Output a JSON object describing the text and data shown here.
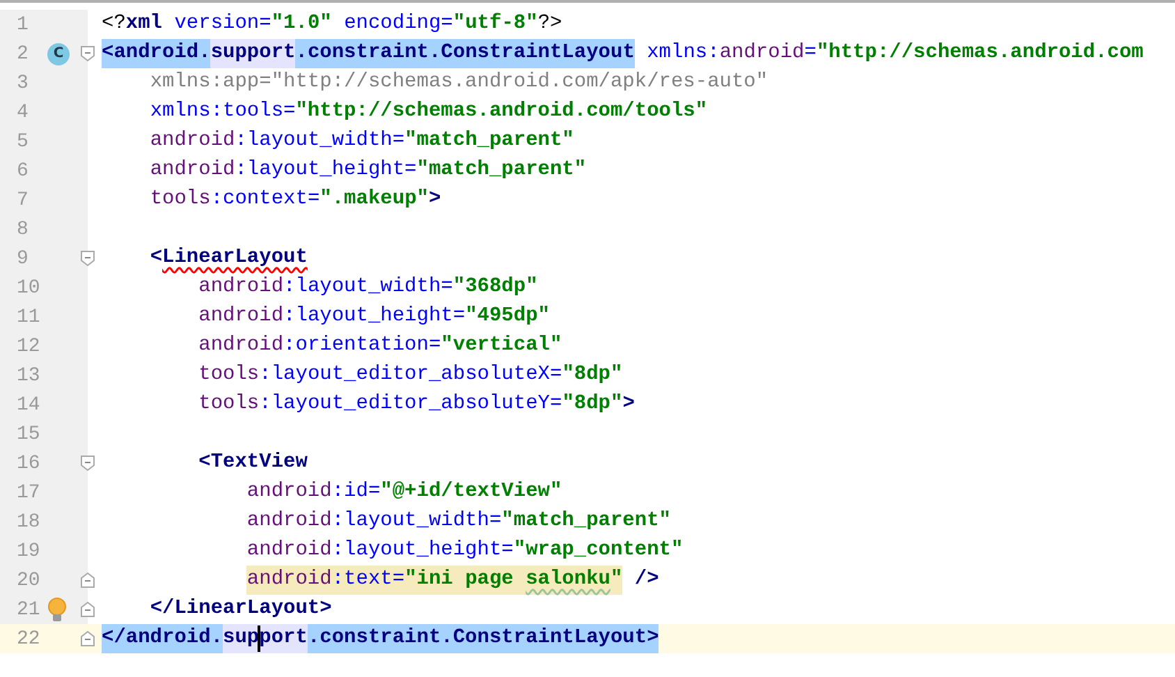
{
  "editor": {
    "lines": [
      {
        "number": "1",
        "current": false,
        "tokens": [
          {
            "kind": "punct",
            "text": "<?"
          },
          {
            "kind": "tag",
            "text": "xml "
          },
          {
            "kind": "attr",
            "text": "version="
          },
          {
            "kind": "value",
            "text": "\"1.0\" "
          },
          {
            "kind": "attr",
            "text": "encoding="
          },
          {
            "kind": "value",
            "text": "\"utf-8\""
          },
          {
            "kind": "punct",
            "text": "?>"
          }
        ]
      },
      {
        "number": "2",
        "current": false,
        "badge": "C",
        "fold_start": true,
        "tokens": [
          {
            "kind": "tag",
            "text": "<android.",
            "selected": true
          },
          {
            "kind": "tag",
            "text": "support",
            "usage": true
          },
          {
            "kind": "tag",
            "text": ".constraint.ConstraintLayout",
            "selected": true
          },
          {
            "kind": "attr",
            "text": " xmlns:"
          },
          {
            "kind": "ns",
            "text": "android"
          },
          {
            "kind": "attr",
            "text": "="
          },
          {
            "kind": "value",
            "text": "\"http://schemas.android.com"
          }
        ]
      },
      {
        "number": "3",
        "current": false,
        "tokens": [
          {
            "kind": "unused",
            "text": "    xmlns:app=\"http://schemas.android.com/apk/res-auto\""
          }
        ]
      },
      {
        "number": "4",
        "current": false,
        "tokens": [
          {
            "kind": "attr",
            "text": "    xmlns:tools="
          },
          {
            "kind": "value",
            "text": "\"http://schemas.android.com/tools\""
          }
        ]
      },
      {
        "number": "5",
        "current": false,
        "tokens": [
          {
            "kind": "ns",
            "text": "    android"
          },
          {
            "kind": "attr",
            "text": ":layout_width="
          },
          {
            "kind": "value",
            "text": "\"match_parent\""
          }
        ]
      },
      {
        "number": "6",
        "current": false,
        "tokens": [
          {
            "kind": "ns",
            "text": "    android"
          },
          {
            "kind": "attr",
            "text": ":layout_height="
          },
          {
            "kind": "value",
            "text": "\"match_parent\""
          }
        ]
      },
      {
        "number": "7",
        "current": false,
        "tokens": [
          {
            "kind": "ns",
            "text": "    tools"
          },
          {
            "kind": "attr",
            "text": ":context="
          },
          {
            "kind": "value",
            "text": "\".makeup\""
          },
          {
            "kind": "tag",
            "text": ">"
          }
        ]
      },
      {
        "number": "8",
        "current": false
      },
      {
        "number": "9",
        "current": false,
        "fold_start": true,
        "tokens": [
          {
            "kind": "tag",
            "text": "    <"
          },
          {
            "kind": "tag",
            "text": "LinearLayout",
            "error_underline": true
          }
        ]
      },
      {
        "number": "10",
        "current": false,
        "tokens": [
          {
            "kind": "ns",
            "text": "        android"
          },
          {
            "kind": "attr",
            "text": ":layout_width="
          },
          {
            "kind": "value",
            "text": "\"368dp\""
          }
        ]
      },
      {
        "number": "11",
        "current": false,
        "tokens": [
          {
            "kind": "ns",
            "text": "        android"
          },
          {
            "kind": "attr",
            "text": ":layout_height="
          },
          {
            "kind": "value",
            "text": "\"495dp\""
          }
        ]
      },
      {
        "number": "12",
        "current": false,
        "tokens": [
          {
            "kind": "ns",
            "text": "        android"
          },
          {
            "kind": "attr",
            "text": ":orientation="
          },
          {
            "kind": "value",
            "text": "\"vertical\""
          }
        ]
      },
      {
        "number": "13",
        "current": false,
        "tokens": [
          {
            "kind": "ns",
            "text": "        tools"
          },
          {
            "kind": "attr",
            "text": ":layout_editor_absoluteX="
          },
          {
            "kind": "value",
            "text": "\"8dp\""
          }
        ]
      },
      {
        "number": "14",
        "current": false,
        "tokens": [
          {
            "kind": "ns",
            "text": "        tools"
          },
          {
            "kind": "attr",
            "text": ":layout_editor_absoluteY="
          },
          {
            "kind": "value",
            "text": "\"8dp\""
          },
          {
            "kind": "tag",
            "text": ">"
          }
        ]
      },
      {
        "number": "15",
        "current": false
      },
      {
        "number": "16",
        "current": false,
        "fold_start": true,
        "tokens": [
          {
            "kind": "tag",
            "text": "        <TextView"
          }
        ]
      },
      {
        "number": "17",
        "current": false,
        "tokens": [
          {
            "kind": "ns",
            "text": "            android"
          },
          {
            "kind": "attr",
            "text": ":id="
          },
          {
            "kind": "value",
            "text": "\"@+id/textView\""
          }
        ]
      },
      {
        "number": "18",
        "current": false,
        "tokens": [
          {
            "kind": "ns",
            "text": "            android"
          },
          {
            "kind": "attr",
            "text": ":layout_width="
          },
          {
            "kind": "value",
            "text": "\"match_parent\""
          }
        ]
      },
      {
        "number": "19",
        "current": false,
        "tokens": [
          {
            "kind": "ns",
            "text": "            android"
          },
          {
            "kind": "attr",
            "text": ":layout_height="
          },
          {
            "kind": "value",
            "text": "\"wrap_content\""
          }
        ]
      },
      {
        "number": "20",
        "current": false,
        "fold_end": true,
        "tokens": [
          {
            "kind": "ns",
            "text": "            android",
            "warning": true
          },
          {
            "kind": "attr",
            "text": ":text=",
            "warning": true
          },
          {
            "kind": "value",
            "text": "\"ini page ",
            "warning": true
          },
          {
            "kind": "value",
            "text": "salonku",
            "warning": true,
            "typo_underline": true
          },
          {
            "kind": "value",
            "text": "\"",
            "warning": true
          },
          {
            "kind": "tag",
            "text": " />"
          }
        ]
      },
      {
        "number": "21",
        "current": false,
        "fold_end": true,
        "bulb": true,
        "tokens": [
          {
            "kind": "tag",
            "text": "    </LinearLayout>"
          }
        ]
      },
      {
        "number": "22",
        "current": true,
        "fold_end": true,
        "tokens": [
          {
            "kind": "tag",
            "text": "</android.",
            "selected": true
          },
          {
            "kind": "tag",
            "text": "sup",
            "usage": true,
            "caret_after": true
          },
          {
            "kind": "tag",
            "text": "port",
            "usage": true
          },
          {
            "kind": "tag",
            "text": ".constraint.ConstraintLayout>",
            "selected": true
          }
        ]
      }
    ]
  }
}
